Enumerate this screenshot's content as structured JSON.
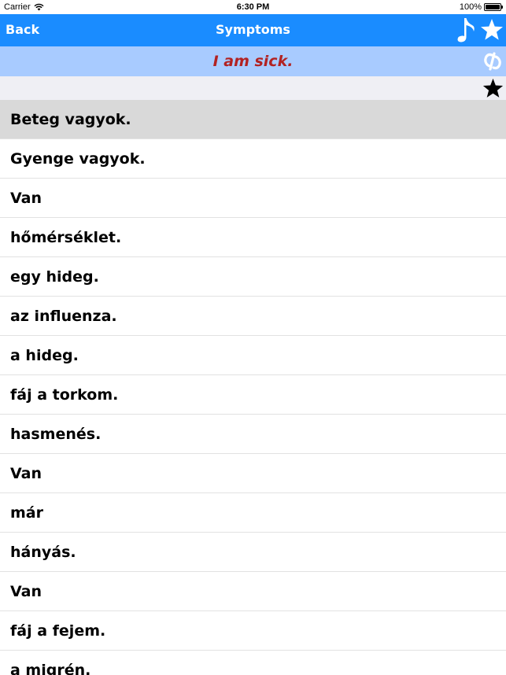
{
  "status_bar": {
    "carrier": "Carrier",
    "time": "6:30 PM",
    "battery": "100%"
  },
  "nav": {
    "back_label": "Back",
    "title": "Symptoms",
    "music_icon": "music-note-icon",
    "favorites_icon": "star-icon"
  },
  "translation": {
    "text": "I am sick.",
    "text_color": "#b22222",
    "link_icon": "link-icon"
  },
  "favorite": {
    "icon": "star-icon"
  },
  "colors": {
    "nav_background": "#1a8cff",
    "translation_background": "#a8cbff",
    "selected_row": "#d9d9d9"
  },
  "phrases": [
    {
      "text": "Beteg vagyok.",
      "selected": true
    },
    {
      "text": "Gyenge vagyok."
    },
    {
      "text": "Van"
    },
    {
      "text": "hőmérséklet."
    },
    {
      "text": "egy hideg."
    },
    {
      "text": "az influenza."
    },
    {
      "text": "a hideg."
    },
    {
      "text": "fáj a torkom."
    },
    {
      "text": "hasmenés."
    },
    {
      "text": "Van"
    },
    {
      "text": "már"
    },
    {
      "text": "hányás."
    },
    {
      "text": "Van"
    },
    {
      "text": "fáj a fejem."
    },
    {
      "text": "a migrén."
    }
  ]
}
